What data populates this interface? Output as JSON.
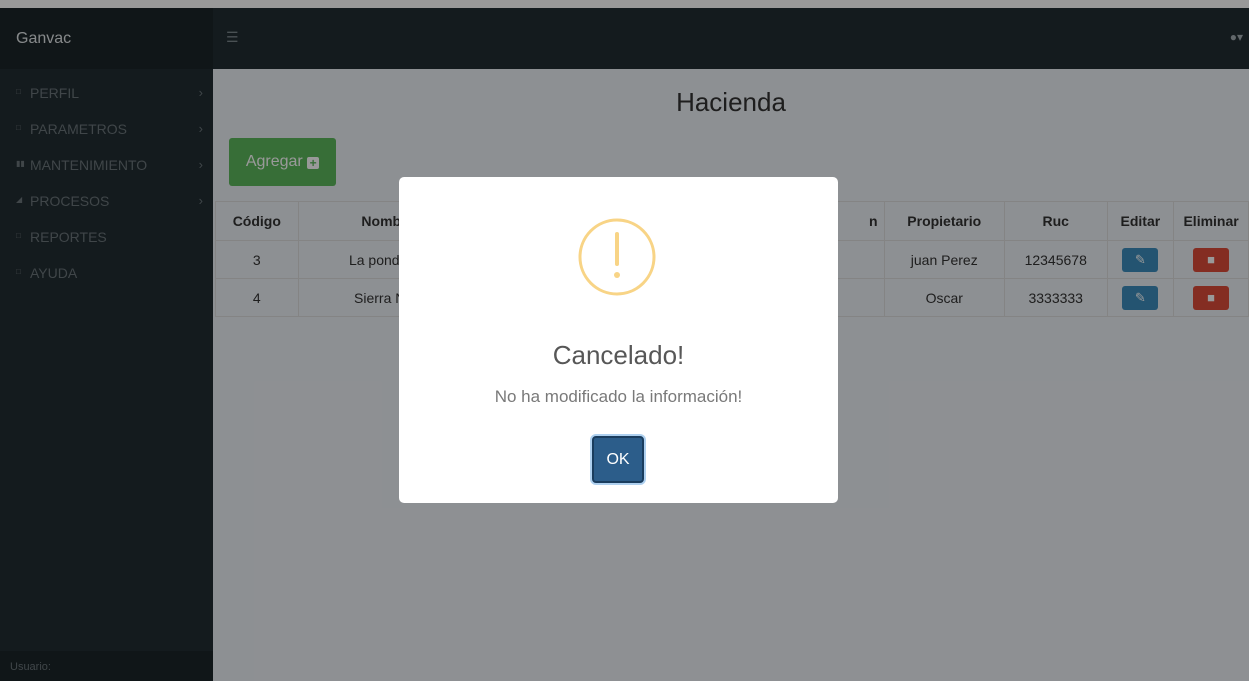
{
  "app": {
    "brand": "Ganvac",
    "menu_icon": "hamburger-icon",
    "user_icon": "user-icon"
  },
  "sidebar": {
    "items": [
      {
        "label": "PERFIL",
        "icon": "square-icon"
      },
      {
        "label": "PARAMETROS",
        "icon": "square-icon"
      },
      {
        "label": "MANTENIMIENTO",
        "icon": "tools-icon"
      },
      {
        "label": "PROCESOS",
        "icon": "chart-icon"
      },
      {
        "label": "REPORTES",
        "icon": "square-icon"
      },
      {
        "label": "AYUDA",
        "icon": "square-icon"
      }
    ],
    "footer": "Usuario:"
  },
  "main": {
    "title": "Hacienda",
    "add_label": "Agregar",
    "table": {
      "headers": [
        "Código",
        "Nombre",
        "n",
        "Propietario",
        "Ruc",
        "Editar",
        "Eliminar"
      ],
      "rows": [
        {
          "codigo": "3",
          "nombre": "La ponderos",
          "propietario": "juan Perez",
          "ruc": "12345678"
        },
        {
          "codigo": "4",
          "nombre": "Sierra Nort",
          "propietario": "Oscar",
          "ruc": "3333333"
        }
      ]
    }
  },
  "modal": {
    "icon": "warning-icon",
    "title": "Cancelado!",
    "text": "No ha modificado la información!",
    "ok_label": "OK",
    "accent_color": "#f8d486"
  }
}
